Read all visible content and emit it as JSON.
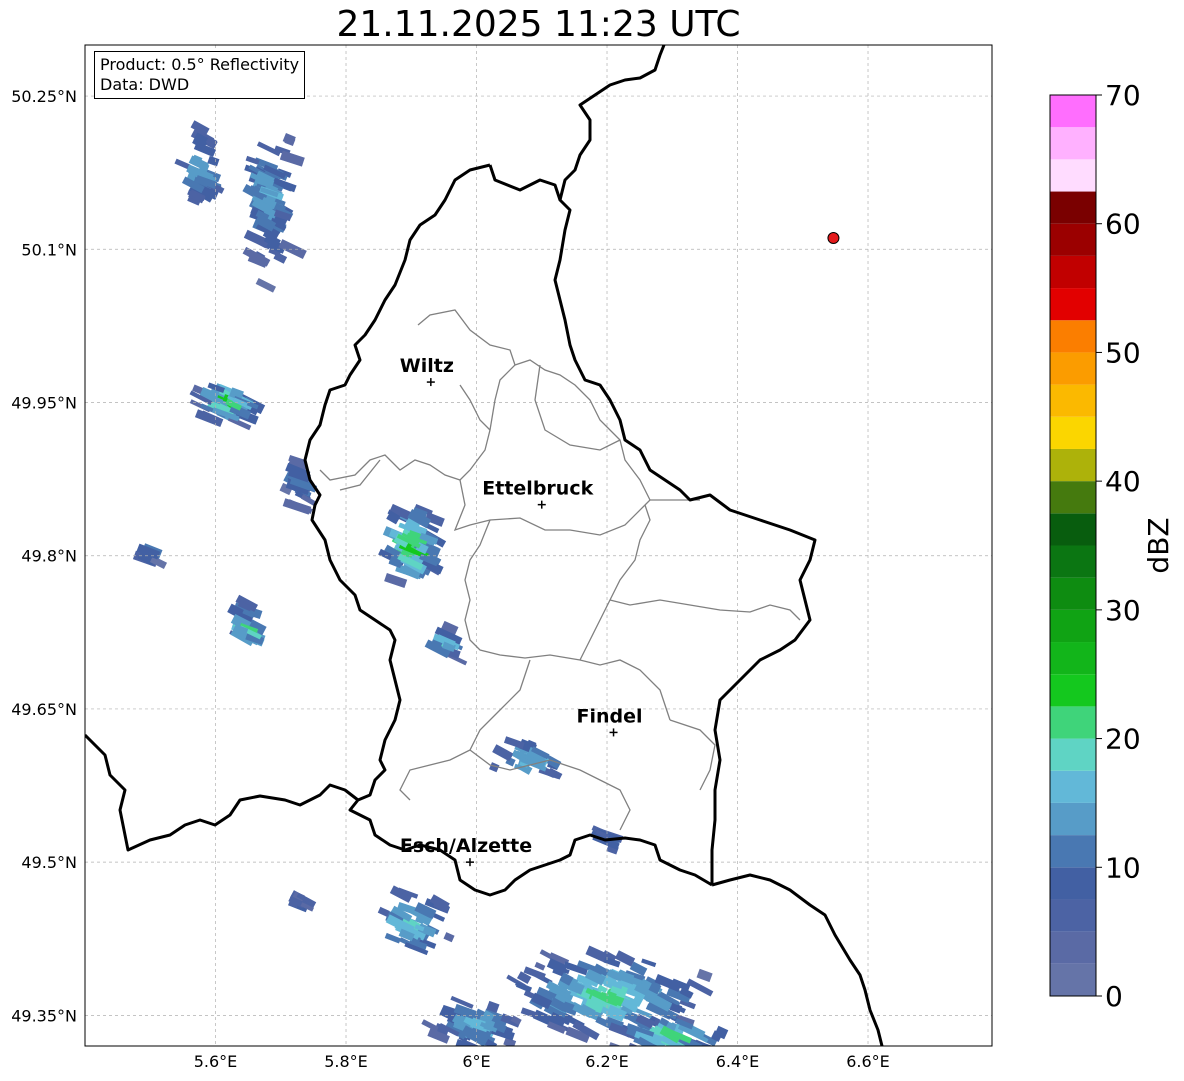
{
  "title": "21.11.2025 11:23 UTC",
  "info": {
    "product": "Product: 0.5° Reflectivity",
    "data": "Data: DWD"
  },
  "extent": {
    "lon": [
      5.4,
      6.79
    ],
    "lat": [
      49.32,
      50.3
    ]
  },
  "gridlines": true,
  "lon_ticks": [
    {
      "value": 5.6,
      "label": "5.6°E"
    },
    {
      "value": 5.8,
      "label": "5.8°E"
    },
    {
      "value": 6.0,
      "label": "6°E"
    },
    {
      "value": 6.2,
      "label": "6.2°E"
    },
    {
      "value": 6.4,
      "label": "6.4°E"
    },
    {
      "value": 6.6,
      "label": "6.6°E"
    }
  ],
  "lat_ticks": [
    {
      "value": 50.25,
      "label": "50.25°N"
    },
    {
      "value": 50.1,
      "label": "50.1°N"
    },
    {
      "value": 49.95,
      "label": "49.95°N"
    },
    {
      "value": 49.8,
      "label": "49.8°N"
    },
    {
      "value": 49.65,
      "label": "49.65°N"
    },
    {
      "value": 49.5,
      "label": "49.5°N"
    },
    {
      "value": 49.35,
      "label": "49.35°N"
    }
  ],
  "cities": [
    {
      "name": "Wiltz",
      "lon": 5.93,
      "lat": 49.97
    },
    {
      "name": "Ettelbruck",
      "lon": 6.1,
      "lat": 49.85
    },
    {
      "name": "Findel",
      "lon": 6.21,
      "lat": 49.627
    },
    {
      "name": "Esch/Alzette",
      "lon": 5.99,
      "lat": 49.5
    }
  ],
  "radar_site": {
    "lon": 6.547,
    "lat": 50.111,
    "color": "#e41a1c"
  },
  "colorbar": {
    "label": "dBZ",
    "min": 0,
    "max": 70,
    "step": 2.5,
    "ticks": [
      0,
      10,
      20,
      30,
      40,
      50,
      60,
      70
    ],
    "colors": [
      "#6574a8",
      "#5a6aa5",
      "#4c63a4",
      "#4260a3",
      "#4978b2",
      "#579cc8",
      "#62b8d8",
      "#5fd4c4",
      "#3fd47a",
      "#14c81e",
      "#12b51a",
      "#10a314",
      "#0e8c11",
      "#0b7612",
      "#085d0e",
      "#457a0e",
      "#adb20a",
      "#fbd600",
      "#fbb900",
      "#fb9c00",
      "#fb7e00",
      "#e20000",
      "#c10000",
      "#9b0000",
      "#7a0000",
      "#ffdcff",
      "#ffb1ff",
      "#ff6efe",
      "#e736ea"
    ]
  },
  "echo_clusters": [
    {
      "lon": 5.58,
      "lat": 50.18,
      "dlon": 0.04,
      "dlat": 0.05,
      "n": 28,
      "max": 14
    },
    {
      "lon": 5.68,
      "lat": 50.15,
      "dlon": 0.05,
      "dlat": 0.09,
      "n": 70,
      "max": 14
    },
    {
      "lon": 5.62,
      "lat": 49.95,
      "dlon": 0.05,
      "dlat": 0.025,
      "n": 45,
      "max": 24
    },
    {
      "lon": 5.73,
      "lat": 49.87,
      "dlon": 0.025,
      "dlat": 0.03,
      "n": 20,
      "max": 10
    },
    {
      "lon": 5.5,
      "lat": 49.8,
      "dlon": 0.015,
      "dlat": 0.015,
      "n": 8,
      "max": 14
    },
    {
      "lon": 5.65,
      "lat": 49.73,
      "dlon": 0.025,
      "dlat": 0.03,
      "n": 22,
      "max": 22
    },
    {
      "lon": 5.9,
      "lat": 49.81,
      "dlon": 0.05,
      "dlat": 0.05,
      "n": 70,
      "max": 24
    },
    {
      "lon": 5.95,
      "lat": 49.71,
      "dlon": 0.02,
      "dlat": 0.025,
      "n": 14,
      "max": 22
    },
    {
      "lon": 6.08,
      "lat": 49.6,
      "dlon": 0.07,
      "dlat": 0.025,
      "n": 30,
      "max": 16
    },
    {
      "lon": 6.2,
      "lat": 49.52,
      "dlon": 0.03,
      "dlat": 0.02,
      "n": 10,
      "max": 10
    },
    {
      "lon": 5.73,
      "lat": 49.46,
      "dlon": 0.02,
      "dlat": 0.015,
      "n": 8,
      "max": 8
    },
    {
      "lon": 5.9,
      "lat": 49.44,
      "dlon": 0.07,
      "dlat": 0.04,
      "n": 40,
      "max": 18
    },
    {
      "lon": 6.0,
      "lat": 49.34,
      "dlon": 0.08,
      "dlat": 0.03,
      "n": 60,
      "max": 16
    },
    {
      "lon": 6.2,
      "lat": 49.37,
      "dlon": 0.18,
      "dlat": 0.05,
      "n": 160,
      "max": 20
    },
    {
      "lon": 6.3,
      "lat": 49.33,
      "dlon": 0.1,
      "dlat": 0.02,
      "n": 50,
      "max": 22
    }
  ]
}
